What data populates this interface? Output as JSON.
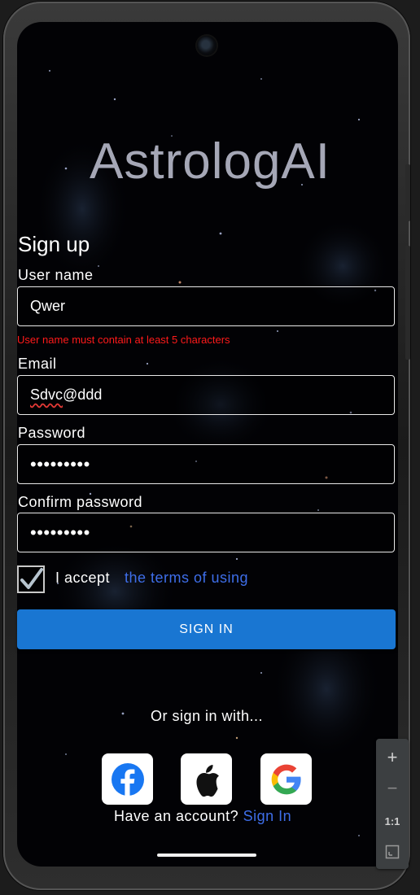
{
  "app": {
    "title": "AstrologAI"
  },
  "form": {
    "heading": "Sign up",
    "username": {
      "label": "User name",
      "value": "Qwer",
      "error": "User name must contain at least 5 characters"
    },
    "email": {
      "label": "Email",
      "value_underlined": "Sdvc",
      "value_rest": "@ddd"
    },
    "password": {
      "label": "Password",
      "masked": "•••••••••"
    },
    "confirm": {
      "label": "Confirm password",
      "masked": "•••••••••"
    },
    "terms": {
      "checked": true,
      "prefix": "I accept",
      "link": "the terms of using"
    },
    "submit_label": "SIGN IN"
  },
  "social": {
    "prompt": "Or sign in with...",
    "providers": [
      "facebook-icon",
      "apple-icon",
      "google-icon"
    ]
  },
  "footer": {
    "question": "Have an account?",
    "link": "Sign In"
  },
  "emulator_zoom": {
    "zoom_in": "+",
    "zoom_out": "−",
    "actual_size": "1:1"
  },
  "colors": {
    "accent": "#1976d2",
    "link": "#3e6ee9",
    "error": "#ff1a1a",
    "title": "#a5a7b6"
  }
}
